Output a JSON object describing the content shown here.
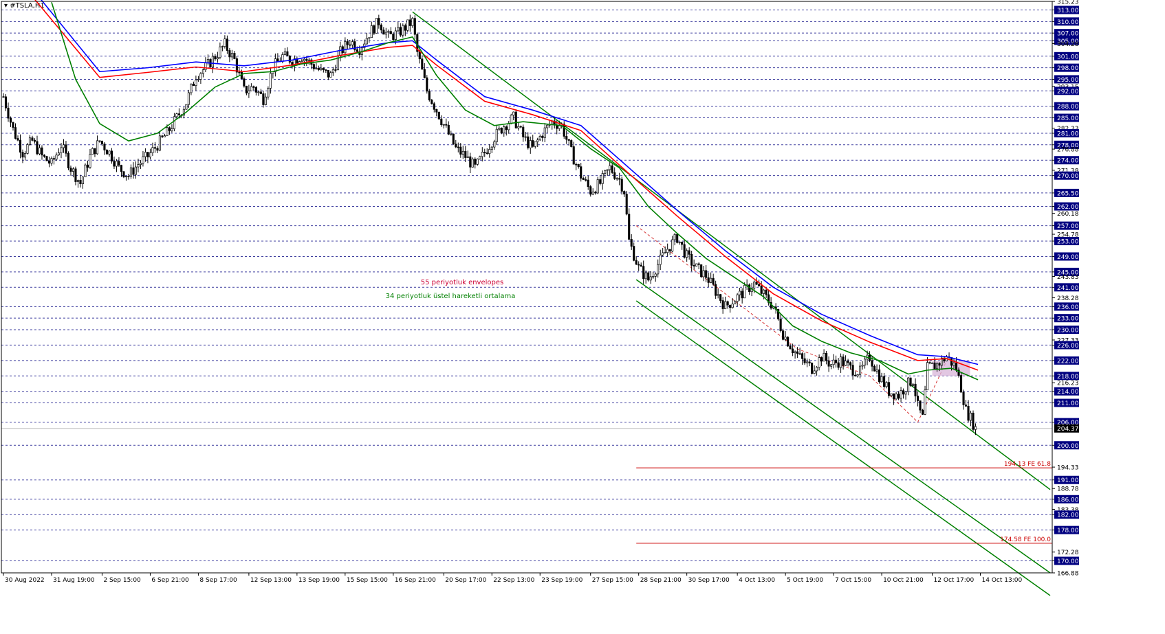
{
  "symbol": "#TSLA,H1",
  "colors": {
    "up_candle": "#000000",
    "down_candle": "#000000",
    "ema34": "#008000",
    "envelope_upper": "#0000ff",
    "envelope_lower": "#ff0000",
    "channel": "#008000",
    "fib_line": "#cc0000",
    "grid": "#000080",
    "current_price_bg": "#000000",
    "zone": "#d8b4d8"
  },
  "chart_data": {
    "type": "candlestick",
    "title": "#TSLA,H1",
    "ylim": [
      166.88,
      315.23
    ],
    "price_ticks": [
      315.23,
      313.0,
      310.0,
      307.0,
      305.0,
      304.28,
      301.0,
      298.0,
      295.0,
      293.15,
      292.0,
      288.0,
      285.0,
      282.33,
      281.0,
      278.0,
      276.88,
      274.0,
      271.38,
      270.0,
      265.5,
      262.0,
      260.18,
      257.0,
      254.78,
      253.0,
      249.0,
      245.0,
      243.83,
      241.0,
      238.28,
      236.0,
      233.0,
      230.0,
      227.33,
      226.0,
      222.0,
      218.0,
      216.23,
      214.0,
      211.0,
      206.0,
      200.0,
      194.33,
      191.0,
      188.78,
      186.0,
      183.38,
      182.0,
      178.0,
      172.28,
      170.0,
      166.88
    ],
    "boxed_levels": [
      313.0,
      310.0,
      307.0,
      305.0,
      301.0,
      298.0,
      295.0,
      292.0,
      288.0,
      285.0,
      281.0,
      278.0,
      274.0,
      270.0,
      265.5,
      262.0,
      257.0,
      253.0,
      249.0,
      245.0,
      241.0,
      236.0,
      233.0,
      230.0,
      226.0,
      222.0,
      218.0,
      214.0,
      211.0,
      206.0,
      200.0,
      191.0,
      186.0,
      182.0,
      178.0,
      170.0
    ],
    "current_price": 204.37,
    "x_labels": [
      "30 Aug 2022",
      "31 Aug 19:00",
      "2 Sep 15:00",
      "6 Sep 21:00",
      "8 Sep 17:00",
      "12 Sep 13:00",
      "13 Sep 19:00",
      "15 Sep 15:00",
      "16 Sep 21:00",
      "20 Sep 17:00",
      "22 Sep 13:00",
      "23 Sep 19:00",
      "27 Sep 15:00",
      "28 Sep 21:00",
      "30 Sep 17:00",
      "4 Oct 13:00",
      "5 Oct 19:00",
      "7 Oct 15:00",
      "10 Oct 21:00",
      "12 Oct 17:00",
      "14 Oct 13:00"
    ],
    "close_path": [
      [
        0,
        290.5
      ],
      [
        4,
        282
      ],
      [
        8,
        276
      ],
      [
        12,
        279
      ],
      [
        16,
        275
      ],
      [
        20,
        273
      ],
      [
        24,
        278
      ],
      [
        28,
        272
      ],
      [
        32,
        268
      ],
      [
        36,
        275
      ],
      [
        40,
        279
      ],
      [
        44,
        276
      ],
      [
        48,
        272
      ],
      [
        52,
        270
      ],
      [
        56,
        273
      ],
      [
        60,
        275
      ],
      [
        64,
        278
      ],
      [
        68,
        281
      ],
      [
        72,
        285
      ],
      [
        76,
        289
      ],
      [
        80,
        296
      ],
      [
        84,
        298
      ],
      [
        88,
        301
      ],
      [
        92,
        304
      ],
      [
        96,
        300
      ],
      [
        100,
        292
      ],
      [
        104,
        293
      ],
      [
        108,
        290
      ],
      [
        112,
        298
      ],
      [
        116,
        301
      ],
      [
        120,
        300
      ],
      [
        124,
        301
      ],
      [
        128,
        299
      ],
      [
        132,
        297
      ],
      [
        136,
        296
      ],
      [
        140,
        302
      ],
      [
        144,
        305
      ],
      [
        148,
        303
      ],
      [
        152,
        307
      ],
      [
        156,
        310
      ],
      [
        160,
        306
      ],
      [
        164,
        307
      ],
      [
        168,
        309
      ],
      [
        170,
        310
      ],
      [
        172,
        302
      ],
      [
        176,
        292
      ],
      [
        180,
        287
      ],
      [
        184,
        282
      ],
      [
        188,
        277
      ],
      [
        192,
        275
      ],
      [
        196,
        272
      ],
      [
        200,
        276
      ],
      [
        204,
        280
      ],
      [
        208,
        283
      ],
      [
        212,
        285
      ],
      [
        216,
        280
      ],
      [
        220,
        277
      ],
      [
        224,
        281
      ],
      [
        228,
        284
      ],
      [
        232,
        283
      ],
      [
        236,
        276
      ],
      [
        240,
        270
      ],
      [
        244,
        266
      ],
      [
        248,
        268
      ],
      [
        252,
        272
      ],
      [
        256,
        269
      ],
      [
        258,
        266
      ],
      [
        260,
        253
      ],
      [
        264,
        246
      ],
      [
        268,
        243
      ],
      [
        272,
        247
      ],
      [
        276,
        251
      ],
      [
        280,
        254
      ],
      [
        284,
        249
      ],
      [
        288,
        246
      ],
      [
        292,
        244
      ],
      [
        296,
        240
      ],
      [
        300,
        236
      ],
      [
        304,
        238
      ],
      [
        308,
        240
      ],
      [
        312,
        242
      ],
      [
        316,
        239
      ],
      [
        320,
        236
      ],
      [
        324,
        229
      ],
      [
        328,
        225
      ],
      [
        332,
        222
      ],
      [
        336,
        220
      ],
      [
        340,
        223
      ],
      [
        344,
        221
      ],
      [
        348,
        222
      ],
      [
        352,
        220
      ],
      [
        356,
        219
      ],
      [
        360,
        223
      ],
      [
        364,
        218
      ],
      [
        368,
        214
      ],
      [
        372,
        213
      ],
      [
        376,
        216
      ],
      [
        378,
        217
      ],
      [
        380,
        210
      ],
      [
        382,
        207
      ],
      [
        384,
        220
      ],
      [
        388,
        221
      ],
      [
        392,
        223
      ],
      [
        396,
        220
      ],
      [
        398,
        215
      ],
      [
        400,
        209
      ],
      [
        402,
        207
      ],
      [
        404,
        204.37
      ]
    ],
    "series": [
      {
        "name": "55 periyotluk envelopes",
        "points": [
          [
            10,
            320
          ],
          [
            40,
            297
          ],
          [
            60,
            298
          ],
          [
            80,
            299.5
          ],
          [
            100,
            298.5
          ],
          [
            120,
            300
          ],
          [
            140,
            302.5
          ],
          [
            160,
            304.5
          ],
          [
            170,
            305
          ],
          [
            180,
            300
          ],
          [
            200,
            290.5
          ],
          [
            220,
            287
          ],
          [
            240,
            283
          ],
          [
            260,
            272
          ],
          [
            280,
            261
          ],
          [
            300,
            250.5
          ],
          [
            320,
            241
          ],
          [
            340,
            234
          ],
          [
            360,
            228.5
          ],
          [
            380,
            223.5
          ],
          [
            392,
            223
          ],
          [
            405,
            221
          ]
        ]
      },
      {
        "name": "55 periyotluk envelopes",
        "points": [
          [
            10,
            318
          ],
          [
            40,
            295.5
          ],
          [
            60,
            296.8
          ],
          [
            80,
            298.2
          ],
          [
            100,
            297
          ],
          [
            120,
            298.7
          ],
          [
            140,
            301.2
          ],
          [
            160,
            303.3
          ],
          [
            170,
            303.8
          ],
          [
            180,
            298.7
          ],
          [
            200,
            289.3
          ],
          [
            220,
            285.8
          ],
          [
            240,
            281.7
          ],
          [
            260,
            270.5
          ],
          [
            280,
            259.5
          ],
          [
            300,
            249
          ],
          [
            320,
            239.3
          ],
          [
            340,
            232.3
          ],
          [
            360,
            226.8
          ],
          [
            380,
            222
          ],
          [
            392,
            222.5
          ],
          [
            405,
            219.5
          ]
        ]
      },
      {
        "name": "34 periyotluk üstel hareketli ortalama",
        "points": [
          [
            20,
            315
          ],
          [
            30,
            295
          ],
          [
            40,
            283.5
          ],
          [
            52,
            279
          ],
          [
            64,
            281
          ],
          [
            76,
            286.5
          ],
          [
            88,
            293
          ],
          [
            100,
            296.5
          ],
          [
            112,
            297
          ],
          [
            124,
            299
          ],
          [
            136,
            300
          ],
          [
            148,
            302
          ],
          [
            160,
            304.5
          ],
          [
            170,
            306
          ],
          [
            180,
            296
          ],
          [
            192,
            287
          ],
          [
            204,
            283
          ],
          [
            216,
            284
          ],
          [
            232,
            283
          ],
          [
            244,
            277
          ],
          [
            256,
            272
          ],
          [
            268,
            262
          ],
          [
            280,
            255
          ],
          [
            292,
            248.5
          ],
          [
            304,
            243.5
          ],
          [
            316,
            238.5
          ],
          [
            328,
            231
          ],
          [
            340,
            227
          ],
          [
            352,
            224
          ],
          [
            364,
            222
          ],
          [
            376,
            218.5
          ],
          [
            384,
            219.5
          ],
          [
            394,
            220
          ],
          [
            405,
            217
          ]
        ]
      }
    ],
    "annotations": {
      "envelopes_label": "55 periyotluk envelopes",
      "ema_label": "34 periyotluk üstel hareketli ortalama",
      "fib_618_label": "194.13 FE 61.8",
      "fib_618_value": 194.13,
      "fib_100_label": "174.58 FE 100.0",
      "fib_100_value": 174.58
    },
    "channels": {
      "upper_channel": [
        [
          170,
          312.5
        ],
        [
          435,
          188.5
        ]
      ],
      "lower_channel_1": [
        [
          263,
          243
        ],
        [
          435,
          166.88
        ]
      ],
      "lower_channel_2": [
        [
          263,
          237.5
        ],
        [
          435,
          161
        ]
      ]
    },
    "fib_projection_path": [
      [
        263,
        257
      ],
      [
        330,
        225
      ],
      [
        360,
        218
      ],
      [
        380,
        206
      ],
      [
        392,
        222
      ]
    ],
    "zone": {
      "start": 386,
      "end": 396,
      "low": 218,
      "high": 222
    }
  }
}
